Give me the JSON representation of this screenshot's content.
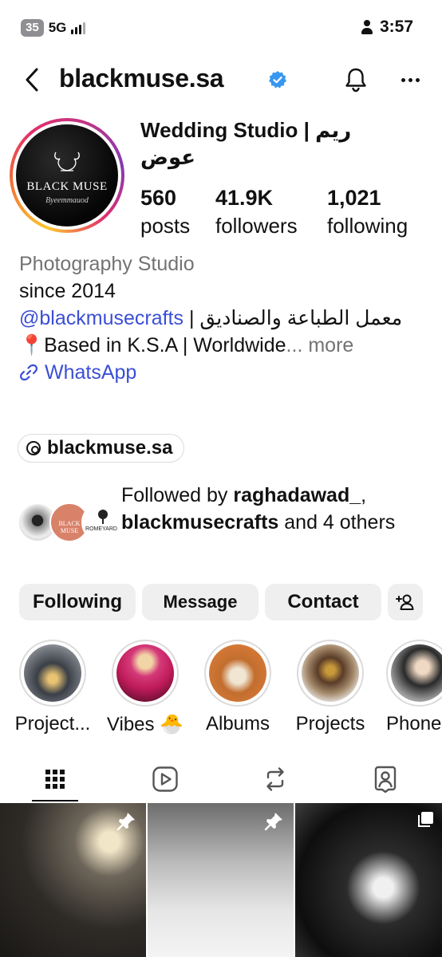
{
  "status_bar": {
    "battery": "35",
    "network": "5G",
    "time": "3:57"
  },
  "header": {
    "username": "blackmuse.sa"
  },
  "profile": {
    "avatar_logo_text": "BLACK MUSE",
    "avatar_logo_sub": "Byeemmauod",
    "display_name": "Wedding Studio | ريم عوض",
    "stats": [
      {
        "value": "560",
        "label": "posts"
      },
      {
        "value": "41.9K",
        "label": "followers"
      },
      {
        "value": "1,021",
        "label": "following"
      }
    ]
  },
  "bio": {
    "category": "Photography Studio",
    "line1": "since 2014",
    "mention": "@blackmusecrafts",
    "mention_suffix": " | معمل الطباعة والصناديق",
    "location": "📍Based in K.S.A | Worldwide",
    "ellipsis": "...",
    "more": " more",
    "link_label": "WhatsApp"
  },
  "threads": {
    "handle": "blackmuse.sa"
  },
  "followed_by": {
    "prefix": "Followed by ",
    "user1": "raghadawad_",
    "sep": ",",
    "user2": "blackmusecrafts",
    "suffix": " and 4 others",
    "avatar2_text": "BLACK MUSE",
    "avatar3_text": "ROMEYARD"
  },
  "actions": {
    "following": "Following",
    "message": "Message",
    "contact": "Contact"
  },
  "highlights": [
    {
      "label": "Project..."
    },
    {
      "label": "Vibes 🐣"
    },
    {
      "label": "Albums"
    },
    {
      "label": "Projects"
    },
    {
      "label": "Phone"
    }
  ],
  "tabs": [
    "grid-icon",
    "reels-icon",
    "reposts-icon",
    "tagged-icon"
  ],
  "colors": {
    "link": "#3b4fd6",
    "secondary_text": "#737373",
    "button_bg": "#efefef",
    "verified": "#3897f0"
  }
}
